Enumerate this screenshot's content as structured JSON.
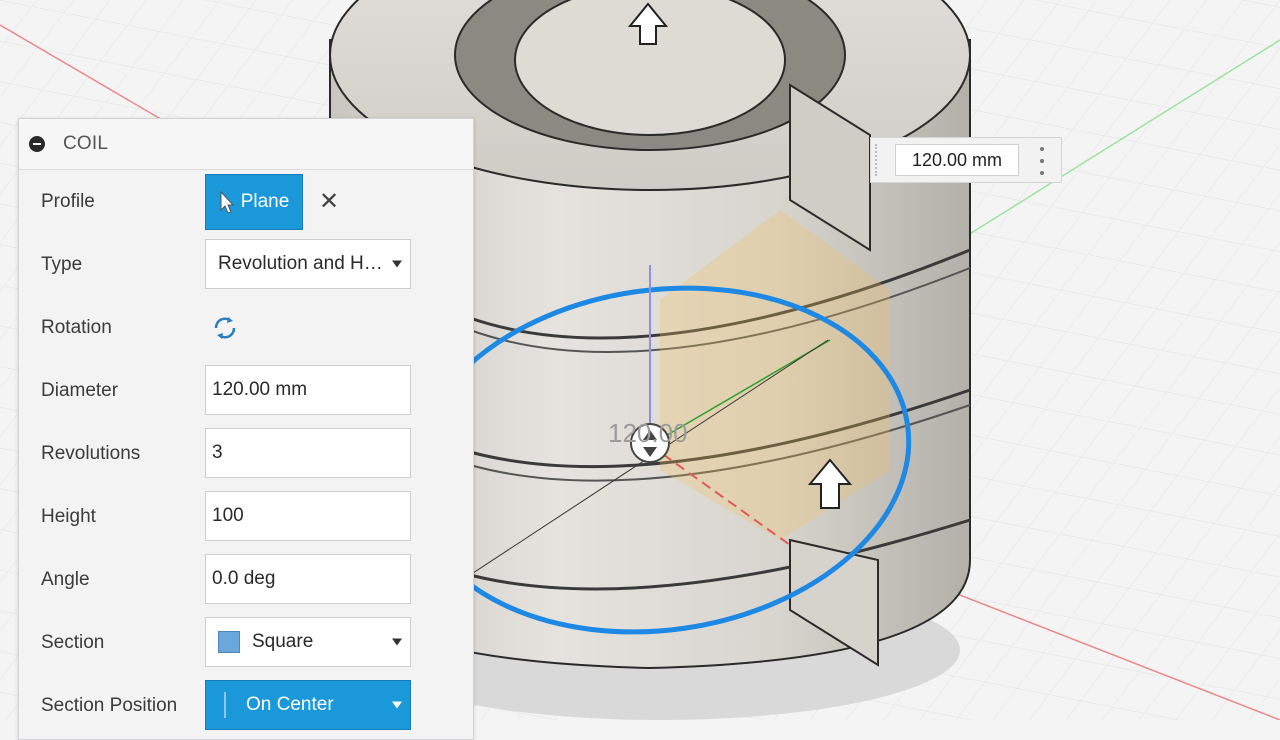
{
  "dialog": {
    "title": "COIL",
    "profile": {
      "label": "Profile",
      "button": "Plane"
    },
    "type": {
      "label": "Type",
      "value": "Revolution and He..."
    },
    "rotation": {
      "label": "Rotation",
      "icon": "rotate-icon"
    },
    "diameter": {
      "label": "Diameter",
      "value": "120.00 mm"
    },
    "revolutions": {
      "label": "Revolutions",
      "value": "3"
    },
    "height": {
      "label": "Height",
      "value": "100"
    },
    "angle": {
      "label": "Angle",
      "value": "0.0 deg"
    },
    "section": {
      "label": "Section",
      "value": "Square",
      "swatch_color": "#6aa8dc"
    },
    "section_position": {
      "label": "Section Position",
      "value": "On Center"
    }
  },
  "viewport": {
    "dimension_input": "120.00 mm",
    "dimension_overlay": "120.00",
    "accent_color": "#1a98d9"
  }
}
